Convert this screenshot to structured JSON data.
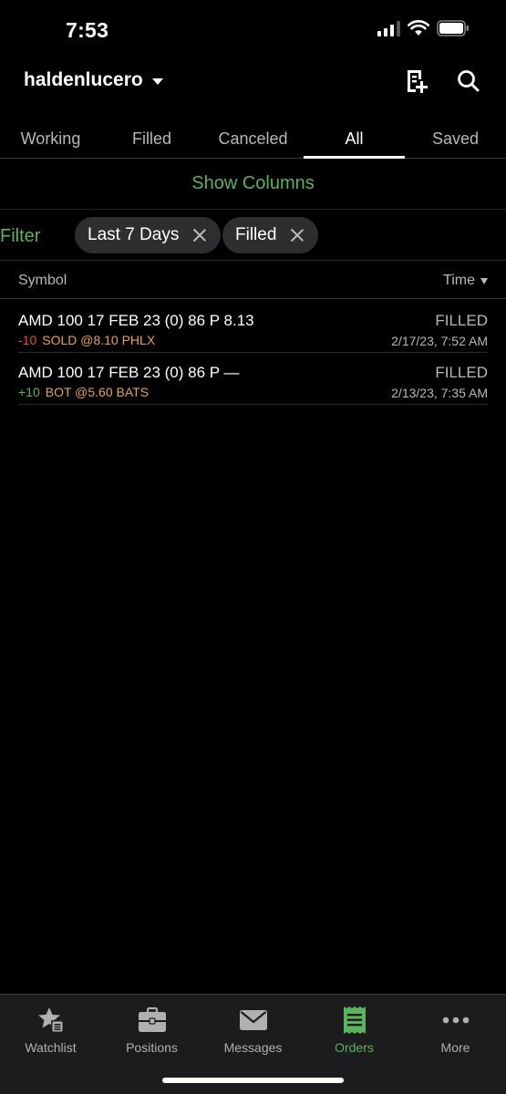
{
  "status_bar": {
    "time": "7:53"
  },
  "header": {
    "account": "haldenlucero"
  },
  "tabs": [
    {
      "label": "Working",
      "active": false
    },
    {
      "label": "Filled",
      "active": false
    },
    {
      "label": "Canceled",
      "active": false
    },
    {
      "label": "All",
      "active": true
    },
    {
      "label": "Saved",
      "active": false
    }
  ],
  "show_columns_label": "Show Columns",
  "filter": {
    "label": "Filter",
    "chips": [
      "Last 7 Days",
      "Filled"
    ]
  },
  "columns": {
    "symbol": "Symbol",
    "time": "Time"
  },
  "orders": [
    {
      "symbol": "AMD 100 17 FEB 23 (0) 86 P 8.13",
      "qty": "-10",
      "fill": "SOLD @8.10 PHLX",
      "status": "FILLED",
      "time": "2/17/23, 7:52 AM"
    },
    {
      "symbol": "AMD 100 17 FEB 23 (0) 86 P —",
      "qty": "+10",
      "fill": "BOT @5.60 BATS",
      "status": "FILLED",
      "time": "2/13/23, 7:35 AM"
    }
  ],
  "bottom_nav": [
    {
      "label": "Watchlist",
      "icon": "watchlist-icon",
      "active": false
    },
    {
      "label": "Positions",
      "icon": "briefcase-icon",
      "active": false
    },
    {
      "label": "Messages",
      "icon": "envelope-icon",
      "active": false
    },
    {
      "label": "Orders",
      "icon": "orders-receipt-icon",
      "active": true
    },
    {
      "label": "More",
      "icon": "more-dots-icon",
      "active": false
    }
  ],
  "colors": {
    "accent_green": "#5bb35a",
    "sell_red": "#e5533c",
    "fill_orange": "#e8a34b",
    "background": "#000000"
  }
}
